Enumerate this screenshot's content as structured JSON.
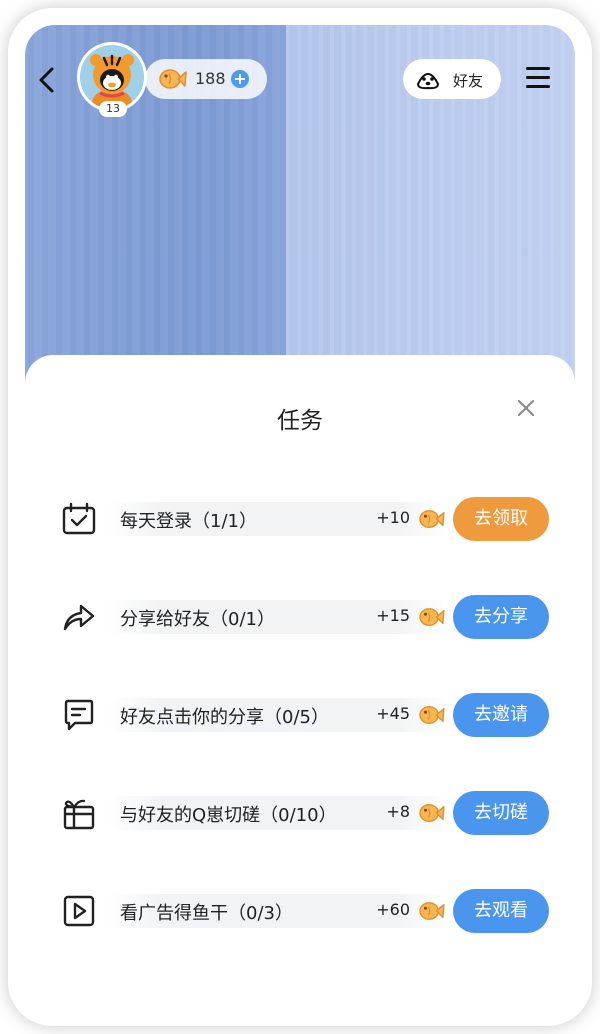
{
  "header": {
    "level": "13",
    "coins": "188",
    "friend_label": "好友",
    "icons": [
      "back-icon",
      "fish-coin-icon",
      "plus-icon",
      "paw-icon",
      "menu-icon"
    ]
  },
  "sheet": {
    "title": "任务",
    "tasks": [
      {
        "label": "每天登录（1/1）",
        "reward": "+10",
        "button": "去领取",
        "icon": "calendar-check-icon",
        "button_color": "#f09a3e"
      },
      {
        "label": "分享给好友（0/1）",
        "reward": "+15",
        "button": "去分享",
        "icon": "share-arrow-icon",
        "button_color": "#4a95ee"
      },
      {
        "label": "好友点击你的分享（0/5）",
        "reward": "+45",
        "button": "去邀请",
        "icon": "message-icon",
        "button_color": "#4a95ee"
      },
      {
        "label": "与好友的Q崽切磋（0/10）",
        "reward": "+8",
        "button": "去切磋",
        "icon": "gift-box-icon",
        "button_color": "#4a95ee"
      },
      {
        "label": "看广告得鱼干（0/3）",
        "reward": "+60",
        "button": "去观看",
        "icon": "play-icon",
        "button_color": "#4a95ee"
      }
    ]
  },
  "colors": {
    "accent_orange": "#f09a3e",
    "accent_blue": "#4a95ee",
    "header_bg_left": "#809dd6",
    "header_bg_right": "#bccdf0"
  }
}
